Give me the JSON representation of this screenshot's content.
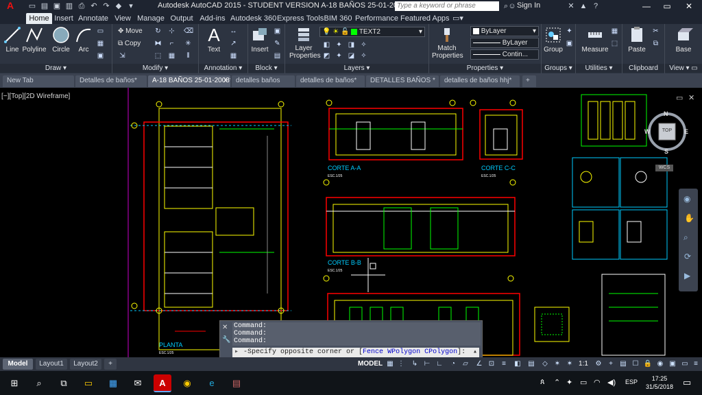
{
  "window": {
    "title": "Autodesk AutoCAD 2015 - STUDENT VERSION    A-18 BAÑOS 25-01-2008.dwg",
    "search_placeholder": "Type a keyword or phrase",
    "signin": "Sign In",
    "app_letter": "A"
  },
  "ribbon_tabs": [
    "Home",
    "Insert",
    "Annotate",
    "View",
    "Manage",
    "Output",
    "Add-ins",
    "Autodesk 360",
    "Express Tools",
    "BIM 360",
    "Performance",
    "Featured Apps"
  ],
  "panels": {
    "draw": "Draw",
    "modify": "Modify",
    "annotation": "Annotation",
    "block": "Block",
    "layers": "Layers",
    "properties": "Properties",
    "groups": "Groups",
    "utilities": "Utilities",
    "clipboard": "Clipboard",
    "view": "View"
  },
  "tools": {
    "line": "Line",
    "polyline": "Polyline",
    "circle": "Circle",
    "arc": "Arc",
    "move": "Move",
    "copy": "Copy",
    "text": "Text",
    "insert": "Insert",
    "layer_properties_1": "Layer",
    "layer_properties_2": "Properties",
    "match_1": "Match",
    "match_2": "Properties",
    "group": "Group",
    "measure": "Measure",
    "paste": "Paste",
    "base": "Base"
  },
  "layer_combo": "TEXT2",
  "props": {
    "color": "ByLayer",
    "lineweight": "ByLayer",
    "linetype": "Contin..."
  },
  "doc_tabs": [
    "New Tab",
    "Detalles de baños*",
    "A-18 BAÑOS 25-01-2008*",
    "detalles baños",
    "detalles de baños*",
    "DETALLES BAÑOS *",
    "detalles de baños hhj*"
  ],
  "active_doc": 2,
  "viewport_label": "[−][Top][2D Wireframe]",
  "drawing": {
    "section_a": "CORTE A-A",
    "section_c": "CORTE C-C",
    "section_b": "CORTE B-B",
    "scale": "ESC.1/25",
    "plan": "PLANTA"
  },
  "compass": {
    "n": "N",
    "s": "S",
    "e": "E",
    "w": "W",
    "top": "TOP",
    "wcs": "WCS"
  },
  "command": {
    "hist1": "Command:",
    "hist2": "Command:",
    "hist3": "Command:",
    "prompt_pre": "-Specify opposite corner or [",
    "fence": "Fence",
    "wpoly": "WPolygon",
    "cpoly": "CPolygon",
    "prompt_post": "]:"
  },
  "layout_tabs": [
    "Model",
    "Layout1",
    "Layout2"
  ],
  "status": {
    "model": "MODEL",
    "scale": "1:1"
  },
  "taskbar": {
    "lang": "ESP",
    "time": "17:25",
    "date": "31/5/2018"
  }
}
